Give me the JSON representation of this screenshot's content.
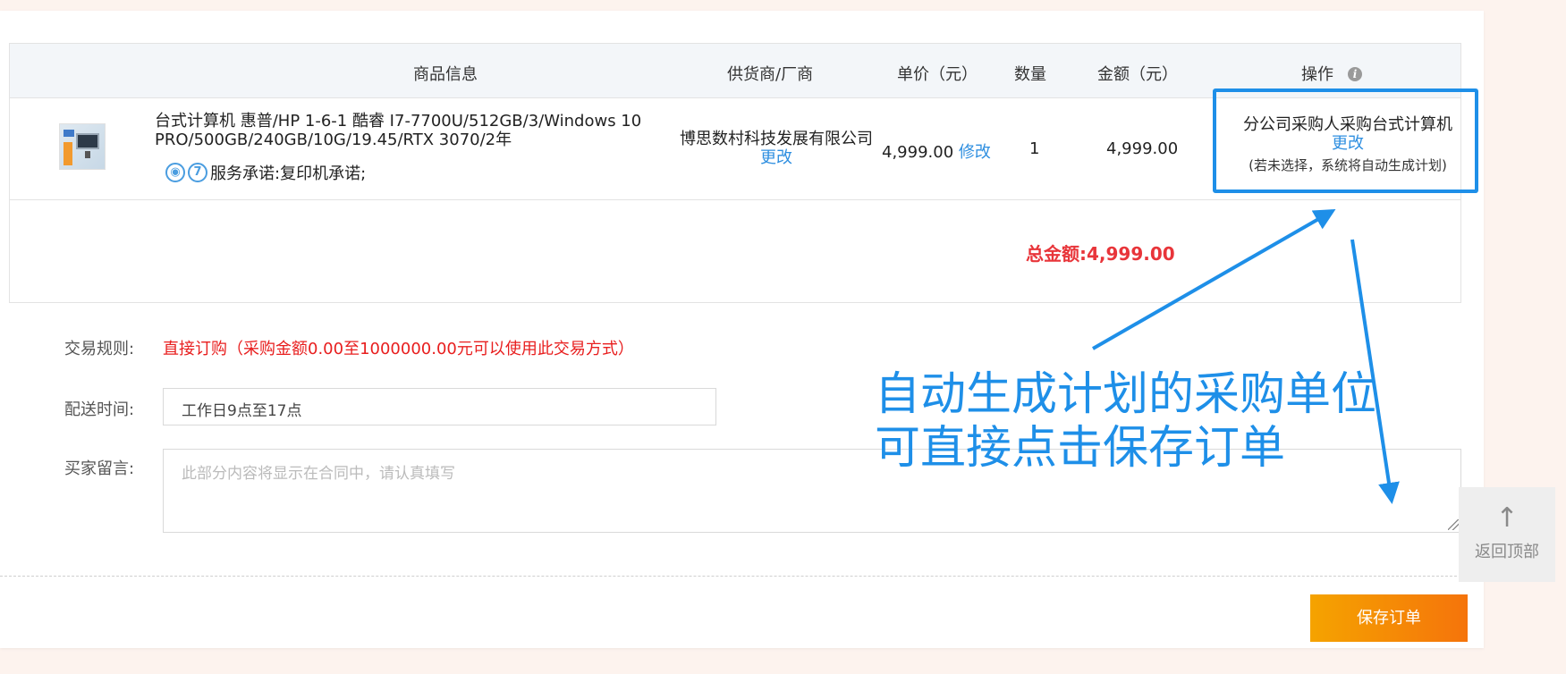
{
  "table": {
    "headers": {
      "product_info": "商品信息",
      "supplier": "供货商/厂商",
      "unit_price": "单价（元）",
      "quantity": "数量",
      "amount": "金额（元）",
      "operation": "操作"
    },
    "row": {
      "product_name": "台式计算机 惠普/HP 1-6-1 酷睿 I7-7700U/512GB/3/Windows 10 PRO/500GB/240GB/10G/19.45/RTX 3070/2年",
      "service_icon_1": "◉",
      "service_icon_2": "7",
      "service_promise": "服务承诺:复印机承诺;",
      "supplier_name": "博思数村科技发展有限公司",
      "supplier_change": "更改",
      "unit_price": "4,999.00",
      "price_edit": "修改",
      "quantity": "1",
      "amount": "4,999.00",
      "plan_name": "分公司采购人采购台式计算机",
      "plan_change": "更改",
      "plan_hint": "(若未选择，系统将自动生成计划)"
    },
    "total": "总金额:4,999.00"
  },
  "form": {
    "rule_label": "交易规则:",
    "rule_value": "直接订购（采购金额0.00至1000000.00元可以使用此交易方式）",
    "delivery_label": "配送时间:",
    "delivery_value": "工作日9点至17点",
    "message_label": "买家留言:",
    "message_placeholder": "此部分内容将显示在合同中，请认真填写"
  },
  "save_button": "保存订单",
  "annotation": {
    "line1": "自动生成计划的采购单位",
    "line2": "可直接点击保存订单"
  },
  "back_to_top": {
    "icon": "↑",
    "label": "返回顶部"
  },
  "colors": {
    "accent_blue": "#1e8fe8",
    "total_red": "#e8353a",
    "rule_red": "#e81e1e",
    "button_orange_start": "#f5a300",
    "button_orange_end": "#f5740b"
  }
}
